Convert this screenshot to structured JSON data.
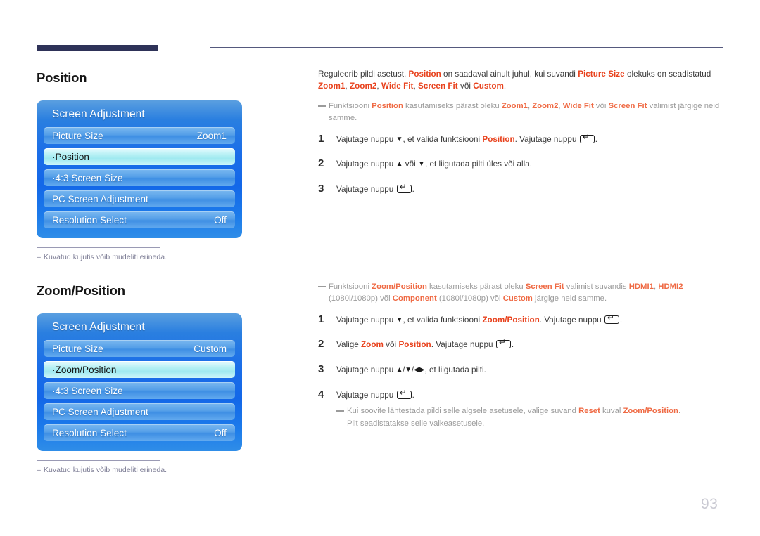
{
  "page": {
    "number": "93"
  },
  "sections": [
    {
      "heading": "Position",
      "osd": {
        "title": "Screen Adjustment",
        "rows": [
          {
            "label": "Picture Size",
            "value": "Zoom1",
            "selected": false
          },
          {
            "label": "·Position",
            "value": "",
            "selected": true
          },
          {
            "label": "·4:3 Screen Size",
            "value": "",
            "selected": false
          },
          {
            "label": "PC Screen Adjustment",
            "value": "",
            "selected": false
          },
          {
            "label": "Resolution Select",
            "value": "Off",
            "selected": false
          }
        ]
      },
      "caption": {
        "dash": "–",
        "text": "Kuvatud kujutis võib mudeliti erineda."
      },
      "intro": {
        "p1_a": "Reguleerib pildi asetust. ",
        "p1_hl1": "Position",
        "p1_b": " on saadaval ainult juhul, kui suvandi ",
        "p1_hl2": "Picture Size",
        "p1_c": " olekuks on seadistatud ",
        "p1_hl3": "Zoom1",
        "p1_d": ", ",
        "p1_hl4": "Zoom2",
        "p1_e": ", ",
        "p1_hl5": "Wide Fit",
        "p1_f": ", ",
        "p1_hl6": "Screen Fit",
        "p1_g": " või ",
        "p1_hl7": "Custom",
        "p1_h": "."
      },
      "note": {
        "a": "Funktsiooni ",
        "hl1": "Position",
        "b": " kasutamiseks pärast oleku ",
        "hl2": "Zoom1",
        "c": ", ",
        "hl3": "Zoom2",
        "d": ", ",
        "hl4": "Wide Fit",
        "e": " või ",
        "hl5": "Screen Fit",
        "f": " valimist järgige neid samme."
      },
      "steps": [
        {
          "num": "1",
          "a": "Vajutage nuppu ",
          "arrow1": "▼",
          "b": ", et valida funktsiooni ",
          "hl": "Position",
          "c": ". Vajutage nuppu ",
          "d": "."
        },
        {
          "num": "2",
          "a": "Vajutage nuppu ",
          "arrow1": "▲",
          "b": " või ",
          "arrow2": "▼",
          "c": ", et liigutada pilti üles või alla."
        },
        {
          "num": "3",
          "a": "Vajutage nuppu ",
          "d": "."
        }
      ]
    },
    {
      "heading": "Zoom/Position",
      "osd": {
        "title": "Screen Adjustment",
        "rows": [
          {
            "label": "Picture Size",
            "value": "Custom",
            "selected": false
          },
          {
            "label": "·Zoom/Position",
            "value": "",
            "selected": true
          },
          {
            "label": "·4:3 Screen Size",
            "value": "",
            "selected": false
          },
          {
            "label": "PC Screen Adjustment",
            "value": "",
            "selected": false
          },
          {
            "label": "Resolution Select",
            "value": "Off",
            "selected": false
          }
        ]
      },
      "caption": {
        "dash": "–",
        "text": "Kuvatud kujutis võib mudeliti erineda."
      },
      "note": {
        "a": "Funktsiooni ",
        "hl1": "Zoom/Position",
        "b": " kasutamiseks pärast oleku ",
        "hl2": "Screen Fit",
        "c": " valimist suvandis ",
        "hl3": "HDMI1",
        "d": ", ",
        "hl4": "HDMI2",
        "e": " (1080i/1080p) või ",
        "hl5": "Component",
        "f": " (1080i/1080p) või ",
        "hl6": "Custom",
        "g": " järgige neid samme."
      },
      "steps": [
        {
          "num": "1",
          "a": "Vajutage nuppu ",
          "arrow1": "▼",
          "b": ", et valida funktsiooni ",
          "hl": "Zoom/Position",
          "c": ". Vajutage nuppu ",
          "d": "."
        },
        {
          "num": "2",
          "a": "Valige ",
          "hl1": "Zoom",
          "b": " või ",
          "hl2": "Position",
          "c": ". Vajutage nuppu ",
          "d": "."
        },
        {
          "num": "3",
          "a": "Vajutage nuppu ",
          "arrows": "▲/▼/◀▶",
          "b": ", et liigutada pilti."
        },
        {
          "num": "4",
          "a": "Vajutage nuppu ",
          "d": "."
        }
      ],
      "subnote": {
        "a": "Kui soovite lähtestada pildi selle algsele asetusele, valige suvand ",
        "hl1": "Reset",
        "b": " kuval ",
        "hl2": "Zoom/Position",
        "c": ".",
        "d": "Pilt seadistatakse selle vaikeasetusele."
      }
    }
  ]
}
